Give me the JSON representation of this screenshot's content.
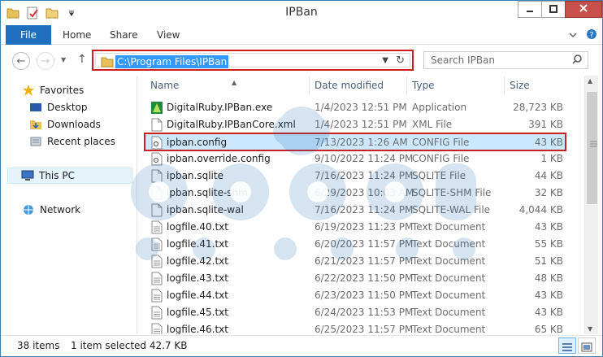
{
  "window": {
    "title": "IPBan",
    "minimize_icon": "minimize-icon",
    "maximize_icon": "maximize-icon",
    "close_icon": "close-icon"
  },
  "ribbon": {
    "tabs": [
      "File",
      "Home",
      "Share",
      "View"
    ],
    "accent": "#1e6fbf"
  },
  "address": {
    "path": "C:\\Program Files\\IPBan",
    "highlight_color": "#cc1f1f"
  },
  "search": {
    "placeholder": "Search IPBan"
  },
  "nav": {
    "favorites": "Favorites",
    "desktop": "Desktop",
    "downloads": "Downloads",
    "recent_places": "Recent places",
    "this_pc": "This PC",
    "network": "Network"
  },
  "columns": {
    "name": "Name",
    "date": "Date modified",
    "type": "Type",
    "size": "Size"
  },
  "files": [
    {
      "name": "DigitalRuby.IPBan.exe",
      "date": "1/4/2023 12:51 PM",
      "type": "Application",
      "size": "28,723 KB",
      "icon": "exe-icon"
    },
    {
      "name": "DigitalRuby.IPBanCore.xml",
      "date": "1/4/2023 12:51 PM",
      "type": "XML File",
      "size": "391 KB",
      "icon": "document-icon"
    },
    {
      "name": "ipban.config",
      "date": "7/13/2023 1:26 AM",
      "type": "CONFIG File",
      "size": "43 KB",
      "icon": "config-icon"
    },
    {
      "name": "ipban.override.config",
      "date": "9/10/2022 11:24 PM",
      "type": "CONFIG File",
      "size": "1 KB",
      "icon": "config-icon"
    },
    {
      "name": "ipban.sqlite",
      "date": "7/16/2023 11:24 PM",
      "type": "SQLITE File",
      "size": "44 KB",
      "icon": "document-icon"
    },
    {
      "name": "ipban.sqlite-shm",
      "date": "6/29/2023 10:03 AM",
      "type": "SQLITE-SHM File",
      "size": "32 KB",
      "icon": "document-icon"
    },
    {
      "name": "ipban.sqlite-wal",
      "date": "7/16/2023 11:24 PM",
      "type": "SQLITE-WAL File",
      "size": "4,044 KB",
      "icon": "document-icon"
    },
    {
      "name": "logfile.40.txt",
      "date": "6/19/2023 11:23 PM",
      "type": "Text Document",
      "size": "43 KB",
      "icon": "text-icon"
    },
    {
      "name": "logfile.41.txt",
      "date": "6/20/2023 11:57 PM",
      "type": "Text Document",
      "size": "55 KB",
      "icon": "text-icon"
    },
    {
      "name": "logfile.42.txt",
      "date": "6/21/2023 11:57 PM",
      "type": "Text Document",
      "size": "51 KB",
      "icon": "text-icon"
    },
    {
      "name": "logfile.43.txt",
      "date": "6/22/2023 11:50 PM",
      "type": "Text Document",
      "size": "48 KB",
      "icon": "text-icon"
    },
    {
      "name": "logfile.44.txt",
      "date": "6/23/2023 11:50 PM",
      "type": "Text Document",
      "size": "43 KB",
      "icon": "text-icon"
    },
    {
      "name": "logfile.45.txt",
      "date": "6/24/2023 11:53 PM",
      "type": "Text Document",
      "size": "43 KB",
      "icon": "text-icon"
    },
    {
      "name": "logfile.46.txt",
      "date": "6/25/2023 11:57 PM",
      "type": "Text Document",
      "size": "65 KB",
      "icon": "text-icon"
    }
  ],
  "selected_index": 2,
  "status": {
    "item_count": "38 items",
    "selection": "1 item selected  42.7 KB"
  }
}
